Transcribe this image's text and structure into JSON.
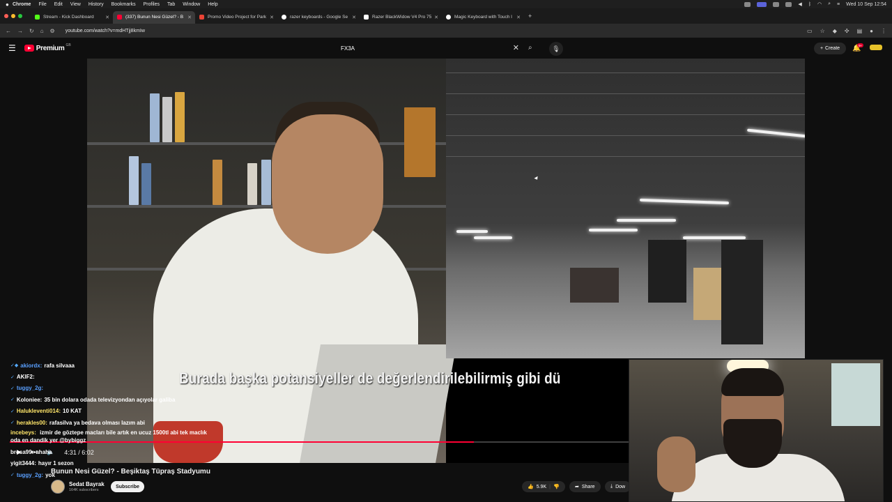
{
  "menubar": {
    "app": "Chrome",
    "items": [
      "File",
      "Edit",
      "View",
      "History",
      "Bookmarks",
      "Profiles",
      "Tab",
      "Window",
      "Help"
    ],
    "clock": "Wed 10 Sep  12:54"
  },
  "tabs": [
    {
      "title": "Stream - Kick Dashboard",
      "color": "#53fc18"
    },
    {
      "title": "(337) Bunun Nesi Güzel? - B",
      "color": "#ff0033",
      "active": true
    },
    {
      "title": "Promo Video Project for Park",
      "color": "#ea4335"
    },
    {
      "title": "razer keyboards - Google Se",
      "color": "#ffffff"
    },
    {
      "title": "Razer BlackWidow V4 Pro 75",
      "color": "#ffffff"
    },
    {
      "title": "Magic Keyboard with Touch I",
      "color": "#ffffff"
    }
  ],
  "address": {
    "url": "youtube.com/watch?v=mdHTjj8kmIw"
  },
  "youtube": {
    "logo": "Premium",
    "logo_region": "GB",
    "search_value": "FX3A",
    "create_label": "Create",
    "notif_count": "9+"
  },
  "video": {
    "subtitle": "Burada başka potansiyeller de değerlendirilebilirmiş gibi dü",
    "time": "4:31 / 6:02",
    "progress": 0.75,
    "title": "Bunun Nesi Güzel? - Beşiktaş Tüpraş Stadyumu"
  },
  "channel": {
    "name": "Sedat Bayrak",
    "subs": "164K subscribers",
    "subscribe_label": "Subscribe"
  },
  "actions": {
    "likes": "5.9K",
    "share": "Share",
    "download": "Dow"
  },
  "chat": [
    {
      "icons": "✓◆",
      "user": "akiordx:",
      "text": "rafa silvaaa",
      "ucolor": "#5aa0ff"
    },
    {
      "icons": "✓",
      "user": "AKIF2:",
      "text": "",
      "ucolor": "#ffffff"
    },
    {
      "icons": "✓",
      "user": "tuggy_2g:",
      "text": "",
      "ucolor": "#5aa0ff"
    },
    {
      "icons": "✓",
      "user": "Koloniee:",
      "text": "35 bin dolara odada televizyondan açıyolar galiba",
      "ucolor": "#ffffff"
    },
    {
      "icons": "✓",
      "user": "Halukleventi014:",
      "text": "10 KAT",
      "ucolor": "#ffe66a"
    },
    {
      "icons": "✓",
      "user": "herakles00:",
      "text": "rafasilva ya bedava olması lazım abi",
      "ucolor": "#ffe66a"
    },
    {
      "icons": "",
      "user": "incebeys:",
      "text": "izmir de göztepe macları bile artık en ucuz 1500tl abi tek maclık oda en dandik yer @bybiggz",
      "ucolor": "#ffe66a"
    },
    {
      "icons": "",
      "user": "brosa99:",
      "text": "ahaha",
      "ucolor": "#ffffff"
    },
    {
      "icons": "",
      "user": "yigit3444:",
      "text": "hayır 1 sezon",
      "ucolor": "#ffffff"
    },
    {
      "icons": "✓",
      "user": "tuggy_2g:",
      "text": "yok",
      "ucolor": "#5aa0ff"
    }
  ]
}
